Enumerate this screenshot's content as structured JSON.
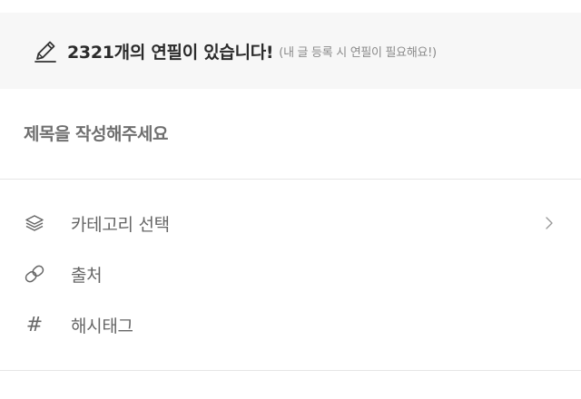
{
  "banner": {
    "icon": "pencil-icon",
    "main_text": "2321개의 연필이 있습니다!",
    "sub_text": "(내 글 등록 시 연필이 필요해요!)"
  },
  "title_field": {
    "placeholder": "제목을 작성해주세요",
    "value": ""
  },
  "options": {
    "category": {
      "icon": "layers-icon",
      "label": "카테고리 선택",
      "trailing_icon": "chevron-right-icon"
    },
    "source": {
      "icon": "link-icon",
      "label": "출처"
    },
    "hashtag": {
      "icon": "hash-icon",
      "glyph": "#",
      "label": "해시태그"
    }
  },
  "colors": {
    "banner_bg": "#f7f7f7",
    "divider": "#e6e6e6",
    "text_primary": "#2b2b2b",
    "text_secondary": "#666666",
    "text_muted": "#8a8a8a"
  }
}
